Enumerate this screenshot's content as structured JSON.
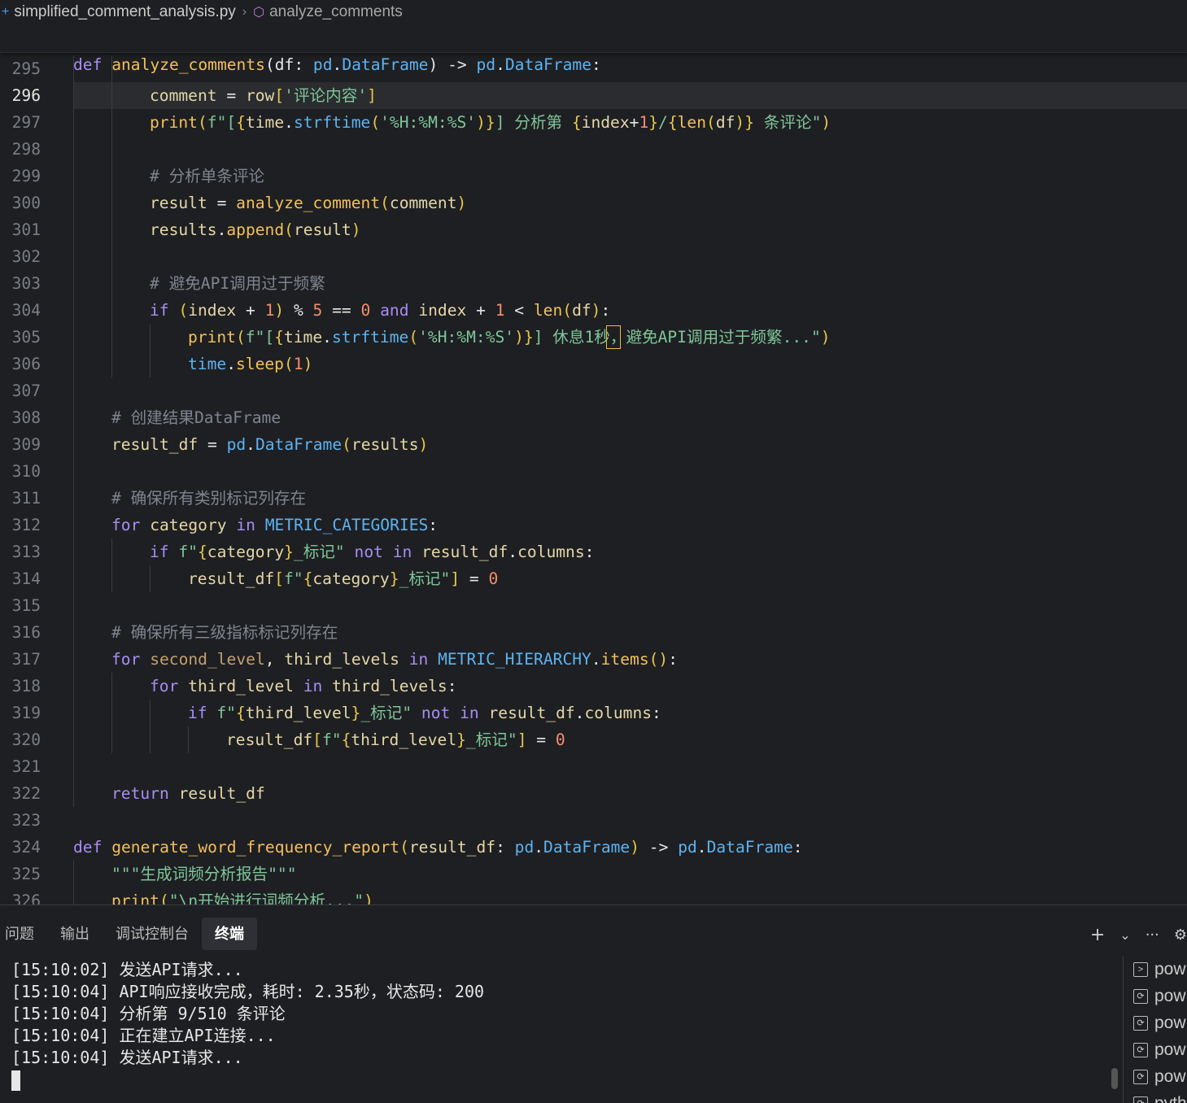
{
  "breadcrumb": {
    "file": "simplified_comment_analysis.py",
    "symbol": "analyze_comments"
  },
  "sticky": {
    "kw": "def",
    "name": "analyze_comments",
    "sig_a": "(df: ",
    "sig_b": "pd",
    "sig_c": ".",
    "sig_d": "DataFrame",
    "sig_e": ") -> ",
    "sig_f": "pd",
    "sig_g": ".",
    "sig_h": "DataFrame",
    "sig_i": ":"
  },
  "lines": [
    {
      "n": "295",
      "t": [],
      "g": [
        90,
        137
      ]
    },
    {
      "n": "296",
      "current": true,
      "g": [
        90,
        137
      ],
      "t": [
        [
          "pl",
          "comment"
        ],
        [
          "op",
          " = "
        ],
        [
          "pl",
          "row"
        ],
        [
          "br",
          "["
        ],
        [
          "str",
          "'评论内容'"
        ],
        [
          "br",
          "]"
        ]
      ]
    },
    {
      "n": "297",
      "g": [
        90,
        137
      ],
      "t": [
        [
          "fn",
          "print"
        ],
        [
          "br",
          "("
        ],
        [
          "str",
          "f\"["
        ],
        [
          "br",
          "{"
        ],
        [
          "pl",
          "time"
        ],
        [
          "op",
          "."
        ],
        [
          "bi",
          "strftime"
        ],
        [
          "br",
          "("
        ],
        [
          "str",
          "'%H:%M:%S'"
        ],
        [
          "br",
          ")"
        ],
        [
          "br",
          "}"
        ],
        [
          "str",
          "] 分析第 "
        ],
        [
          "br",
          "{"
        ],
        [
          "pl",
          "index"
        ],
        [
          "op",
          "+"
        ],
        [
          "num",
          "1"
        ],
        [
          "br",
          "}"
        ],
        [
          "str",
          "/"
        ],
        [
          "br",
          "{"
        ],
        [
          "fn",
          "len"
        ],
        [
          "br",
          "("
        ],
        [
          "pl",
          "df"
        ],
        [
          "br",
          ")"
        ],
        [
          "br",
          "}"
        ],
        [
          "str",
          " 条评论\""
        ],
        [
          "br",
          ")"
        ]
      ]
    },
    {
      "n": "298",
      "g": [
        90,
        137
      ],
      "t": []
    },
    {
      "n": "299",
      "g": [
        90,
        137
      ],
      "t": [
        [
          "cm",
          "# 分析单条评论"
        ]
      ]
    },
    {
      "n": "300",
      "g": [
        90,
        137
      ],
      "t": [
        [
          "pl",
          "result"
        ],
        [
          "op",
          " = "
        ],
        [
          "fn",
          "analyze_comment"
        ],
        [
          "br",
          "("
        ],
        [
          "pl",
          "comment"
        ],
        [
          "br",
          ")"
        ]
      ]
    },
    {
      "n": "301",
      "g": [
        90,
        137
      ],
      "t": [
        [
          "pl",
          "results"
        ],
        [
          "op",
          "."
        ],
        [
          "fn",
          "append"
        ],
        [
          "br",
          "("
        ],
        [
          "pl",
          "result"
        ],
        [
          "br",
          ")"
        ]
      ]
    },
    {
      "n": "302",
      "g": [
        90,
        137
      ],
      "t": []
    },
    {
      "n": "303",
      "g": [
        90,
        137
      ],
      "t": [
        [
          "cm",
          "# 避免API调用过于频繁"
        ]
      ]
    },
    {
      "n": "304",
      "g": [
        90,
        137
      ],
      "t": [
        [
          "kw",
          "if"
        ],
        [
          "op",
          " "
        ],
        [
          "br",
          "("
        ],
        [
          "pl",
          "index"
        ],
        [
          "op",
          " + "
        ],
        [
          "num",
          "1"
        ],
        [
          "br",
          ")"
        ],
        [
          "op",
          " % "
        ],
        [
          "num",
          "5"
        ],
        [
          "op",
          " == "
        ],
        [
          "num",
          "0"
        ],
        [
          "op",
          " "
        ],
        [
          "kw",
          "and"
        ],
        [
          "op",
          " "
        ],
        [
          "pl",
          "index"
        ],
        [
          "op",
          " + "
        ],
        [
          "num",
          "1"
        ],
        [
          "op",
          " < "
        ],
        [
          "fn",
          "len"
        ],
        [
          "br",
          "("
        ],
        [
          "pl",
          "df"
        ],
        [
          "br",
          ")"
        ],
        [
          "op",
          ":"
        ]
      ]
    },
    {
      "n": "305",
      "g": [
        90,
        137,
        184
      ],
      "caret": true,
      "t": [
        [
          "fn",
          "print"
        ],
        [
          "br",
          "("
        ],
        [
          "str",
          "f\"["
        ],
        [
          "br",
          "{"
        ],
        [
          "pl",
          "time"
        ],
        [
          "op",
          "."
        ],
        [
          "bi",
          "strftime"
        ],
        [
          "br",
          "("
        ],
        [
          "str",
          "'%H:%M:%S'"
        ],
        [
          "br",
          ")"
        ],
        [
          "br",
          "}"
        ],
        [
          "str",
          "] 休息1秒，避免API调用过于频繁...\""
        ],
        [
          "br",
          ")"
        ]
      ]
    },
    {
      "n": "306",
      "g": [
        90,
        137,
        184
      ],
      "t": [
        [
          "bi",
          "time"
        ],
        [
          "op",
          "."
        ],
        [
          "fn",
          "sleep"
        ],
        [
          "br",
          "("
        ],
        [
          "num",
          "1"
        ],
        [
          "br",
          ")"
        ]
      ]
    },
    {
      "n": "307",
      "g": [
        90
      ],
      "t": []
    },
    {
      "n": "308",
      "g": [
        90
      ],
      "t": [
        [
          "cm",
          "# 创建结果DataFrame"
        ]
      ]
    },
    {
      "n": "309",
      "g": [
        90
      ],
      "t": [
        [
          "pl",
          "result_df"
        ],
        [
          "op",
          " = "
        ],
        [
          "cn",
          "pd"
        ],
        [
          "op",
          "."
        ],
        [
          "bi",
          "DataFrame"
        ],
        [
          "br",
          "("
        ],
        [
          "pl",
          "results"
        ],
        [
          "br",
          ")"
        ]
      ]
    },
    {
      "n": "310",
      "g": [
        90
      ],
      "t": []
    },
    {
      "n": "311",
      "g": [
        90
      ],
      "t": [
        [
          "cm",
          "# 确保所有类别标记列存在"
        ]
      ]
    },
    {
      "n": "312",
      "g": [
        90
      ],
      "t": [
        [
          "kw",
          "for"
        ],
        [
          "op",
          " "
        ],
        [
          "pl",
          "category"
        ],
        [
          "op",
          " "
        ],
        [
          "kw",
          "in"
        ],
        [
          "op",
          " "
        ],
        [
          "cn",
          "METRIC_CATEGORIES"
        ],
        [
          "op",
          ":"
        ]
      ]
    },
    {
      "n": "313",
      "g": [
        90,
        137
      ],
      "t": [
        [
          "kw",
          "if"
        ],
        [
          "op",
          " "
        ],
        [
          "str",
          "f\""
        ],
        [
          "br",
          "{"
        ],
        [
          "pl",
          "category"
        ],
        [
          "br",
          "}"
        ],
        [
          "str",
          "_标记\""
        ],
        [
          "op",
          " "
        ],
        [
          "kw",
          "not"
        ],
        [
          "op",
          " "
        ],
        [
          "kw",
          "in"
        ],
        [
          "op",
          " "
        ],
        [
          "pl",
          "result_df"
        ],
        [
          "op",
          "."
        ],
        [
          "pl",
          "columns"
        ],
        [
          "op",
          ":"
        ]
      ]
    },
    {
      "n": "314",
      "g": [
        90,
        137,
        184
      ],
      "t": [
        [
          "pl",
          "result_df"
        ],
        [
          "br",
          "["
        ],
        [
          "str",
          "f\""
        ],
        [
          "br",
          "{"
        ],
        [
          "pl",
          "category"
        ],
        [
          "br",
          "}"
        ],
        [
          "str",
          "_标记\""
        ],
        [
          "br",
          "]"
        ],
        [
          "op",
          " = "
        ],
        [
          "num",
          "0"
        ]
      ]
    },
    {
      "n": "315",
      "g": [
        90
      ],
      "t": []
    },
    {
      "n": "316",
      "g": [
        90
      ],
      "t": [
        [
          "cm",
          "# 确保所有三级指标标记列存在"
        ]
      ]
    },
    {
      "n": "317",
      "g": [
        90
      ],
      "t": [
        [
          "kw",
          "for"
        ],
        [
          "op",
          " "
        ],
        [
          "par",
          "second_level"
        ],
        [
          "op",
          ", "
        ],
        [
          "pl",
          "third_levels"
        ],
        [
          "op",
          " "
        ],
        [
          "kw",
          "in"
        ],
        [
          "op",
          " "
        ],
        [
          "cn",
          "METRIC_HIERARCHY"
        ],
        [
          "op",
          "."
        ],
        [
          "fn",
          "items"
        ],
        [
          "br",
          "()"
        ],
        [
          "op",
          ":"
        ]
      ]
    },
    {
      "n": "318",
      "g": [
        90,
        137
      ],
      "t": [
        [
          "kw",
          "for"
        ],
        [
          "op",
          " "
        ],
        [
          "pl",
          "third_level"
        ],
        [
          "op",
          " "
        ],
        [
          "kw",
          "in"
        ],
        [
          "op",
          " "
        ],
        [
          "pl",
          "third_levels"
        ],
        [
          "op",
          ":"
        ]
      ]
    },
    {
      "n": "319",
      "g": [
        90,
        137,
        184
      ],
      "t": [
        [
          "kw",
          "if"
        ],
        [
          "op",
          " "
        ],
        [
          "str",
          "f\""
        ],
        [
          "br",
          "{"
        ],
        [
          "pl",
          "third_level"
        ],
        [
          "br",
          "}"
        ],
        [
          "str",
          "_标记\""
        ],
        [
          "op",
          " "
        ],
        [
          "kw",
          "not"
        ],
        [
          "op",
          " "
        ],
        [
          "kw",
          "in"
        ],
        [
          "op",
          " "
        ],
        [
          "pl",
          "result_df"
        ],
        [
          "op",
          "."
        ],
        [
          "pl",
          "columns"
        ],
        [
          "op",
          ":"
        ]
      ]
    },
    {
      "n": "320",
      "g": [
        90,
        137,
        184,
        231
      ],
      "t": [
        [
          "pl",
          "result_df"
        ],
        [
          "br",
          "["
        ],
        [
          "str",
          "f\""
        ],
        [
          "br",
          "{"
        ],
        [
          "pl",
          "third_level"
        ],
        [
          "br",
          "}"
        ],
        [
          "str",
          "_标记\""
        ],
        [
          "br",
          "]"
        ],
        [
          "op",
          " = "
        ],
        [
          "num",
          "0"
        ]
      ]
    },
    {
      "n": "321",
      "g": [
        90
      ],
      "t": []
    },
    {
      "n": "322",
      "g": [
        90
      ],
      "t": [
        [
          "kw",
          "return"
        ],
        [
          "op",
          " "
        ],
        [
          "pl",
          "result_df"
        ]
      ]
    },
    {
      "n": "323",
      "g": [],
      "t": []
    },
    {
      "n": "324",
      "g": [],
      "t": [
        [
          "kw",
          "def"
        ],
        [
          "op",
          " "
        ],
        [
          "fn",
          "generate_word_frequency_report"
        ],
        [
          "br",
          "("
        ],
        [
          "pl",
          "result_df"
        ],
        [
          "op",
          ": "
        ],
        [
          "cn",
          "pd"
        ],
        [
          "op",
          "."
        ],
        [
          "bi",
          "DataFrame"
        ],
        [
          "br",
          ")"
        ],
        [
          "op",
          " -> "
        ],
        [
          "cn",
          "pd"
        ],
        [
          "op",
          "."
        ],
        [
          "bi",
          "DataFrame"
        ],
        [
          "op",
          ":"
        ]
      ]
    },
    {
      "n": "325",
      "g": [
        90
      ],
      "t": [
        [
          "str",
          "\"\"\"生成词频分析报告\"\"\""
        ]
      ]
    },
    {
      "n": "326",
      "g": [
        90
      ],
      "t": [
        [
          "fn",
          "print"
        ],
        [
          "br",
          "("
        ],
        [
          "str",
          "\"\\n开始进行词频分析...\""
        ],
        [
          "br",
          ")"
        ]
      ]
    }
  ],
  "indent": {
    "295": 2,
    "296": 2,
    "297": 2,
    "298": 2,
    "299": 2,
    "300": 2,
    "301": 2,
    "302": 2,
    "303": 2,
    "304": 2,
    "305": 3,
    "306": 3,
    "307": 1,
    "308": 1,
    "309": 1,
    "310": 1,
    "311": 1,
    "312": 1,
    "313": 2,
    "314": 3,
    "315": 1,
    "316": 1,
    "317": 1,
    "318": 2,
    "319": 3,
    "320": 4,
    "321": 1,
    "322": 1,
    "323": 0,
    "324": 0,
    "325": 1,
    "326": 1
  },
  "panel": {
    "tabs": [
      "问题",
      "输出",
      "调试控制台",
      "终端"
    ],
    "active_tab": "终端",
    "actions": {
      "add": "+",
      "chevron": "⌄",
      "more": "···",
      "settings": "⚙"
    }
  },
  "terminal": {
    "lines": [
      "[15:10:02] 发送API请求...",
      "[15:10:04] API响应接收完成，耗时: 2.35秒，状态码: 200",
      "[15:10:04] 分析第 9/510 条评论",
      "[15:10:04] 正在建立API连接...",
      "[15:10:04] 发送API请求..."
    ]
  },
  "terminal_list": [
    {
      "icon": "terminal-icon",
      "label": "pow"
    },
    {
      "icon": "terminal-python-icon",
      "label": "pow"
    },
    {
      "icon": "terminal-python-icon",
      "label": "pow"
    },
    {
      "icon": "terminal-python-icon",
      "label": "pow"
    },
    {
      "icon": "terminal-python-icon",
      "label": "pow"
    },
    {
      "icon": "terminal-python-icon",
      "label": "pyth"
    }
  ]
}
